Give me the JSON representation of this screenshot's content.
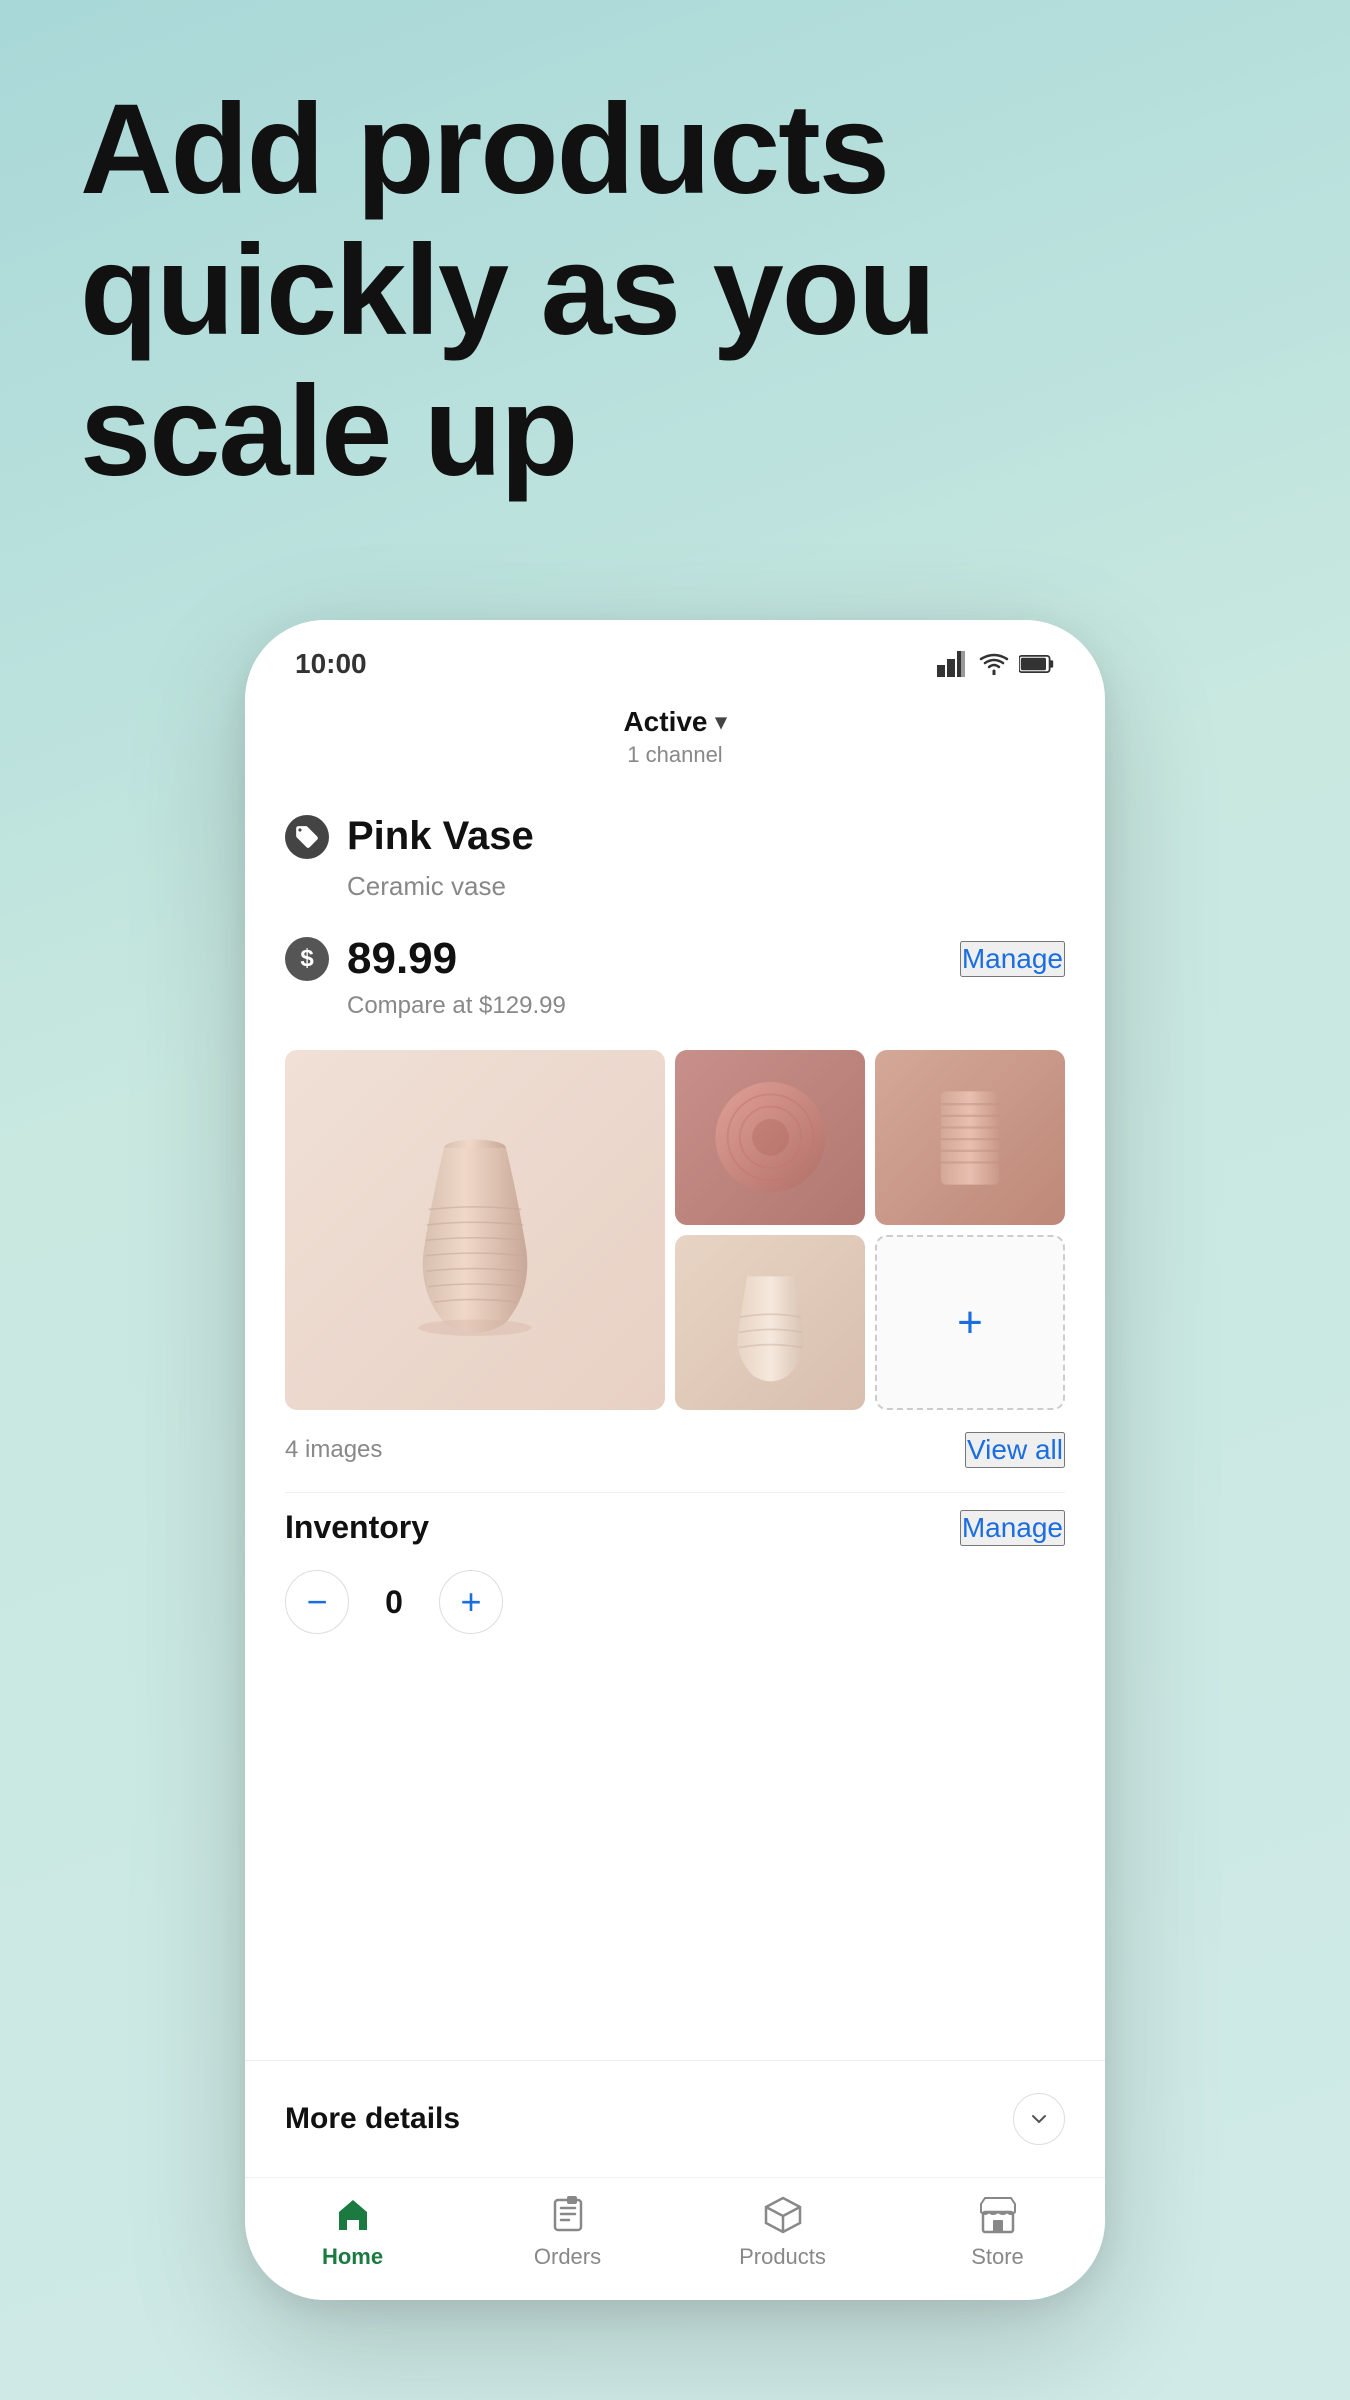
{
  "hero": {
    "title_line1": "Add products",
    "title_line2": "quickly as you",
    "title_line3": "scale up"
  },
  "status_bar": {
    "time": "10:00"
  },
  "active_channel": {
    "label": "Active",
    "channel_count": "1 channel"
  },
  "product": {
    "name": "Pink Vase",
    "description": "Ceramic vase",
    "price": "89.99",
    "compare_price": "Compare at $129.99",
    "manage_price_label": "Manage",
    "images_count": "4 images",
    "view_all_label": "View all"
  },
  "inventory": {
    "title": "Inventory",
    "manage_label": "Manage",
    "quantity": "0",
    "decrement_label": "−",
    "increment_label": "+"
  },
  "more_details": {
    "label": "More details"
  },
  "bottom_nav": {
    "items": [
      {
        "id": "home",
        "label": "Home",
        "active": true
      },
      {
        "id": "orders",
        "label": "Orders",
        "active": false
      },
      {
        "id": "products",
        "label": "Products",
        "active": false
      },
      {
        "id": "store",
        "label": "Store",
        "active": false
      }
    ]
  }
}
